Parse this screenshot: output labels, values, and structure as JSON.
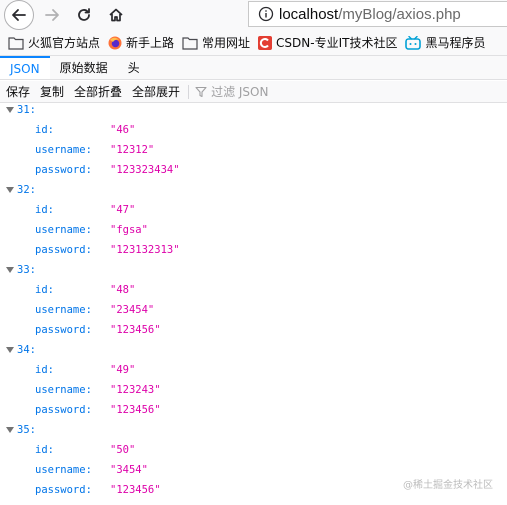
{
  "browser": {
    "url_host": "localhost",
    "url_path": "/myBlog/axios.php"
  },
  "bookmarks": [
    {
      "icon": "folder-icon",
      "label": "火狐官方站点"
    },
    {
      "icon": "firefox-icon",
      "label": "新手上路"
    },
    {
      "icon": "folder-icon",
      "label": "常用网址"
    },
    {
      "icon": "csdn-icon",
      "label": "CSDN-专业IT技术社区"
    },
    {
      "icon": "bilibili-icon",
      "label": "黑马程序员"
    }
  ],
  "viewer": {
    "tabs": [
      "JSON",
      "原始数据",
      "头"
    ],
    "toolbar": [
      "保存",
      "复制",
      "全部折叠",
      "全部展开"
    ],
    "filter_placeholder": "过滤 JSON"
  },
  "records": [
    {
      "index": "31:",
      "id": "\"46\"",
      "username": "\"12312\"",
      "password": "\"123323434\""
    },
    {
      "index": "32:",
      "id": "\"47\"",
      "username": "\"fgsa\"",
      "password": "\"123132313\""
    },
    {
      "index": "33:",
      "id": "\"48\"",
      "username": "\"23454\"",
      "password": "\"123456\""
    },
    {
      "index": "34:",
      "id": "\"49\"",
      "username": "\"123243\"",
      "password": "\"123456\""
    },
    {
      "index": "35:",
      "id": "\"50\"",
      "username": "\"3454\"",
      "password": "\"123456\""
    }
  ],
  "field_labels": {
    "id": "id:",
    "username": "username:",
    "password": "password:"
  },
  "watermark": "@稀土掘金技术社区",
  "colors": {
    "accent": "#0a84ff",
    "key": "#0074e8",
    "string_value": "#dd00a9"
  }
}
